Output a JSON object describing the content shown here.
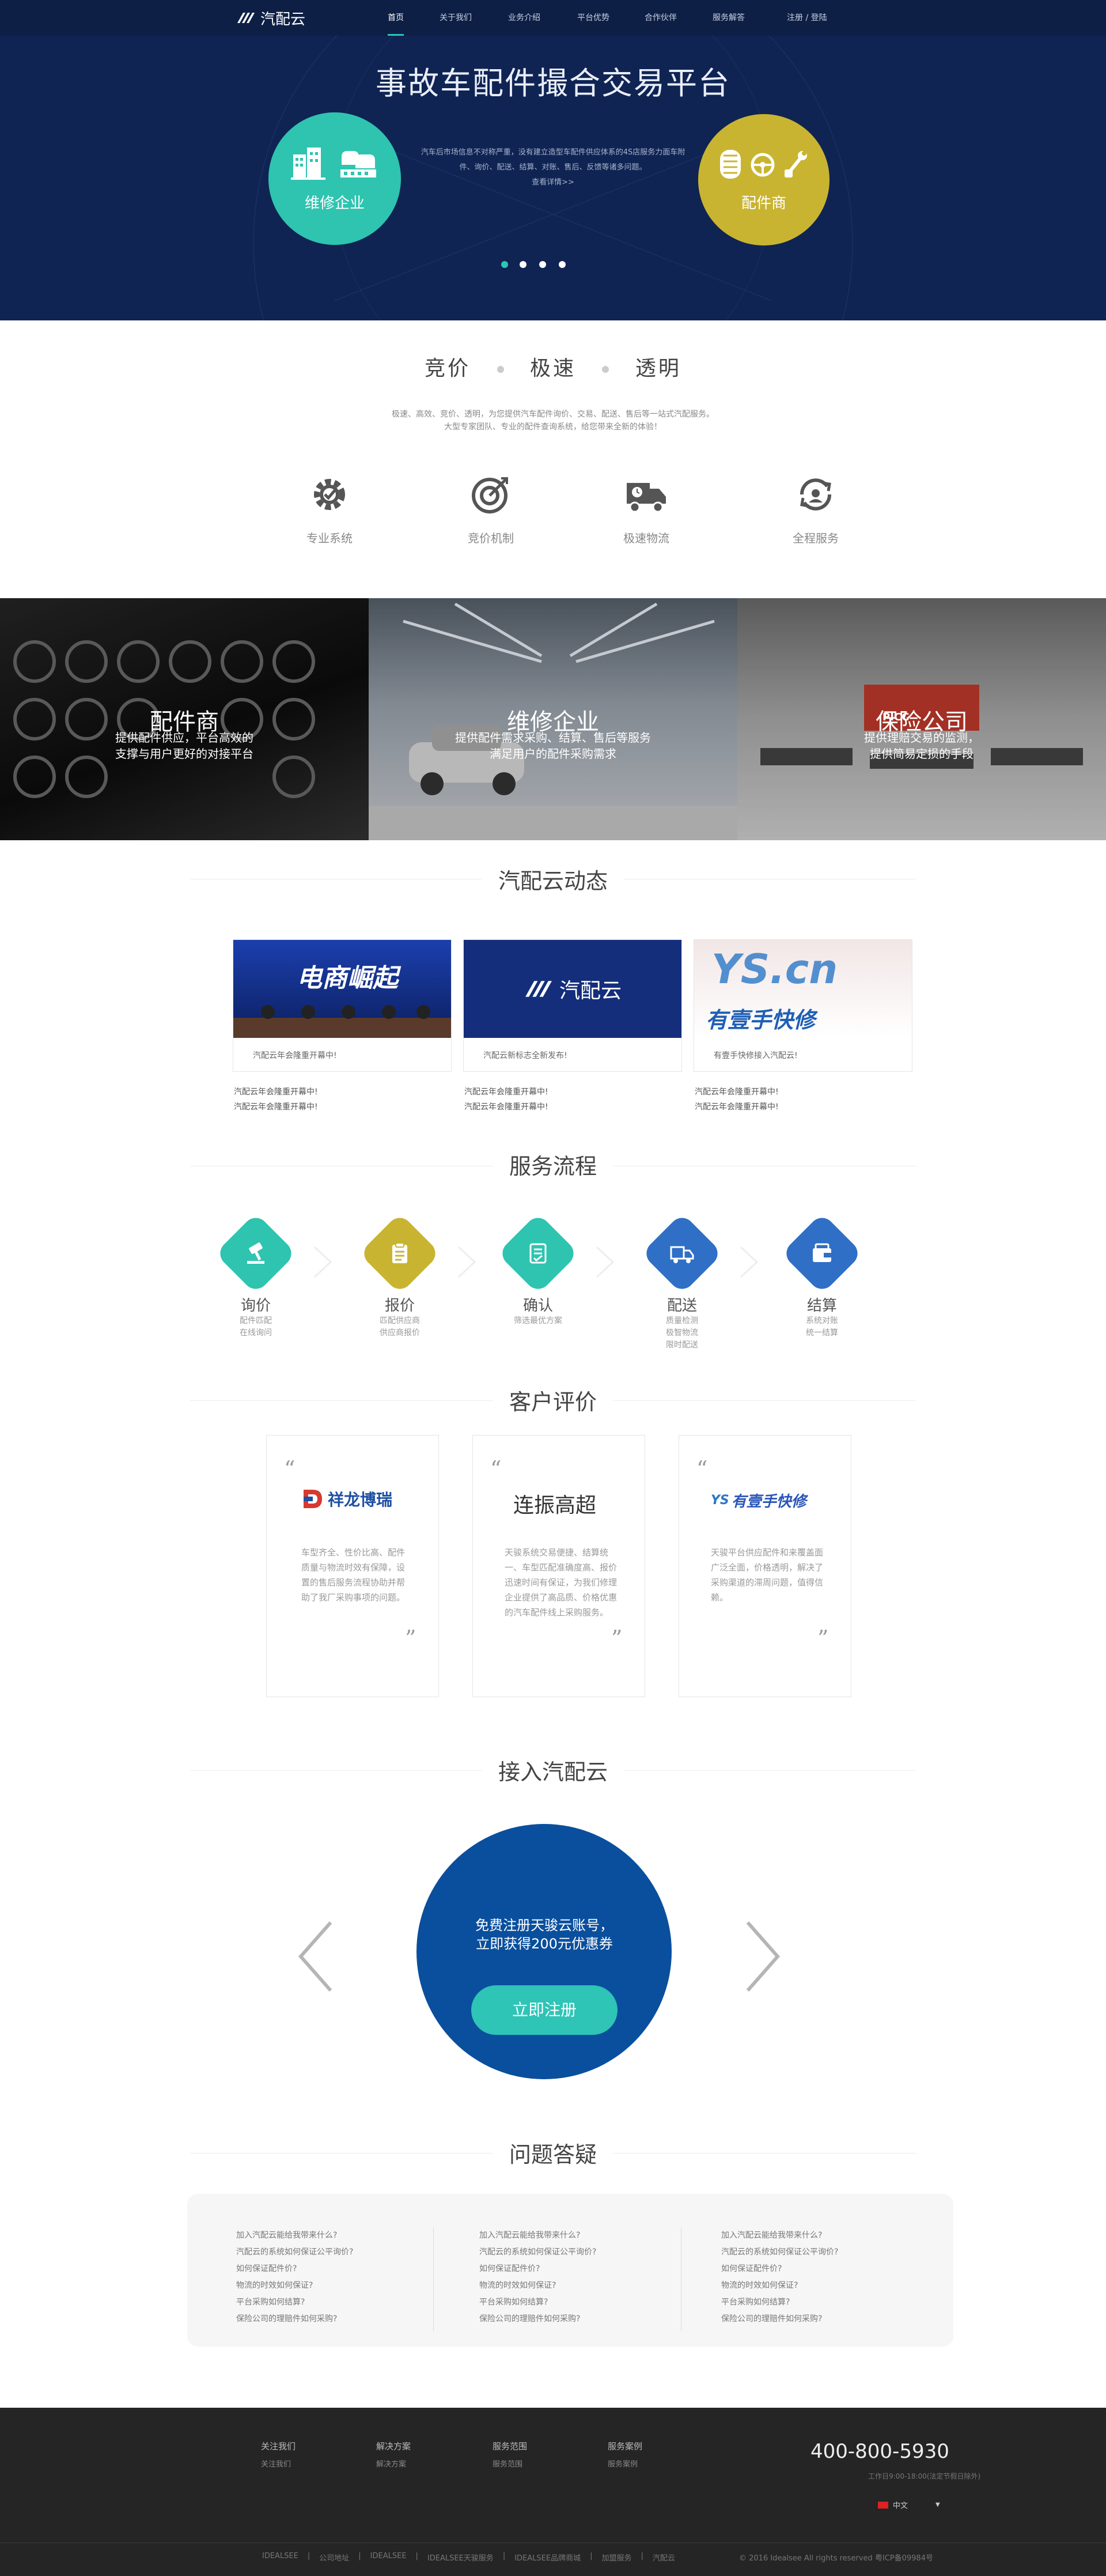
{
  "nav": {
    "logo_text": "汽配云",
    "items": [
      {
        "label": "首页",
        "active": true
      },
      {
        "label": "关于我们"
      },
      {
        "label": "业务介绍"
      },
      {
        "label": "平台优势"
      },
      {
        "label": "合作伙伴"
      },
      {
        "label": "服务解答"
      }
    ],
    "login": "注册 / 登陆"
  },
  "hero": {
    "title": "事故车配件撮合交易平台",
    "left_label": "维修企业",
    "right_label": "配件商",
    "desc": "汽车后市场信息不对称严重，没有建立造型车配件供应体系的4S店服务力面车附件、询价、配送、结算、对账、售后、反馈等诸多问题。",
    "more": "查看详情>>",
    "slides": 4,
    "active_slide": 0,
    "colors": {
      "bg": "#0f2453",
      "teal": "#2ec4b0",
      "gold": "#c9b431"
    }
  },
  "slogan": {
    "words": [
      "竞价",
      "极速",
      "透明"
    ],
    "desc1": "极速、高效、竞价、透明，为您提供汽车配件询价、交易、配送、售后等一站式汽配服务。",
    "desc2": "大型专家团队、专业的配件查询系统，给您带来全新的体验！",
    "features": [
      {
        "label": "专业系统",
        "icon": "gear-icon"
      },
      {
        "label": "竞价机制",
        "icon": "target-icon"
      },
      {
        "label": "极速物流",
        "icon": "truck-icon"
      },
      {
        "label": "全程服务",
        "icon": "service-cycle-icon"
      }
    ]
  },
  "photos": [
    {
      "title": "配件商",
      "sub1": "提供配件供应，平台高效的",
      "sub2": "支撑与用户更好的对接平台"
    },
    {
      "title": "维修企业",
      "sub1": "提供配件需求采购、结算、售后等服务",
      "sub2": "满足用户的配件采购需求"
    },
    {
      "title": "保险公司",
      "sub1": "提供理赔交易的监测，",
      "sub2": "提供简易定损的手段"
    }
  ],
  "news": {
    "title": "汽配云动态",
    "cards": [
      {
        "img_text": "电商崛起",
        "caption": "汽配云年会隆重开幕中!"
      },
      {
        "img_text": "汽配云",
        "caption": "汽配云新标志全新发布!"
      },
      {
        "img_text": "有壹手快修",
        "caption": "有壹手快修接入汽配云!"
      }
    ],
    "lines": [
      "汽配云年会隆重开幕中!",
      "汽配云年会隆重开幕中!"
    ]
  },
  "process": {
    "title": "服务流程",
    "steps": [
      {
        "name": "询价",
        "sub1": "配件匹配",
        "sub2": "在线询问",
        "color": "#2ec4b0",
        "icon": "hammer-icon"
      },
      {
        "name": "报价",
        "sub1": "匹配供应商",
        "sub2": "供应商报价",
        "color": "#c9b431",
        "icon": "clipboard-icon"
      },
      {
        "name": "确认",
        "sub1": "筛选最优方案",
        "sub2": "",
        "color": "#2ec4b0",
        "icon": "checklist-icon"
      },
      {
        "name": "配送",
        "sub1": "质量检测",
        "sub2": "极智物流",
        "sub3": "限时配送",
        "color": "#2f6fc6",
        "icon": "delivery-truck-icon"
      },
      {
        "name": "结算",
        "sub1": "系统对账",
        "sub2": "统一结算",
        "color": "#2f6fc6",
        "icon": "wallet-icon"
      }
    ]
  },
  "reviews": {
    "title": "客户评价",
    "items": [
      {
        "brand": "祥龙博瑞",
        "text": "车型齐全、性价比高、配件质量与物流时效有保障，设置的售后服务流程协助并帮助了我厂采购事项的问题。"
      },
      {
        "brand": "连振高超",
        "text": "天骏系统交易便捷、结算统一、车型匹配准确度高、报价迅速时间有保证，为我们修理企业提供了高品质、价格优惠的汽车配件线上采购服务。"
      },
      {
        "brand": "有壹手快修",
        "text": "天骏平台供应配件和来覆盖面广泛全面，价格透明，解决了采购渠道的滞周问题，值得信赖。"
      }
    ]
  },
  "join": {
    "title": "接入汽配云",
    "line1": "免费注册天骏云账号，",
    "line2": "立即获得200元优惠券",
    "button": "立即注册"
  },
  "faq": {
    "title": "问题答疑",
    "items": [
      "加入汽配云能给我带来什么?",
      "汽配云的系统如何保证公平询价?",
      "如何保证配件价?",
      "物流的时效如何保证?",
      "平台采购如何结算?",
      "保险公司的理赔件如何采购?"
    ]
  },
  "footer": {
    "cols": [
      {
        "head": "关注我们",
        "sub": "关注我们"
      },
      {
        "head": "解决方案",
        "sub": "解决方案"
      },
      {
        "head": "服务范围",
        "sub": "服务范围"
      },
      {
        "head": "服务案例",
        "sub": "服务案例"
      }
    ],
    "phone": "400-800-5930",
    "hours": "工作日9:00-18:00(法定节假日除外)",
    "lang": "中文",
    "links": [
      "IDEALSEE",
      "公司地址",
      "IDEALSEE",
      "IDEALSEE天骏服务",
      "IDEALSEE品牌商城",
      "加盟服务",
      "汽配云"
    ],
    "copyright": "© 2016 Idealsee All rights reserved 粤ICP备09984号"
  }
}
